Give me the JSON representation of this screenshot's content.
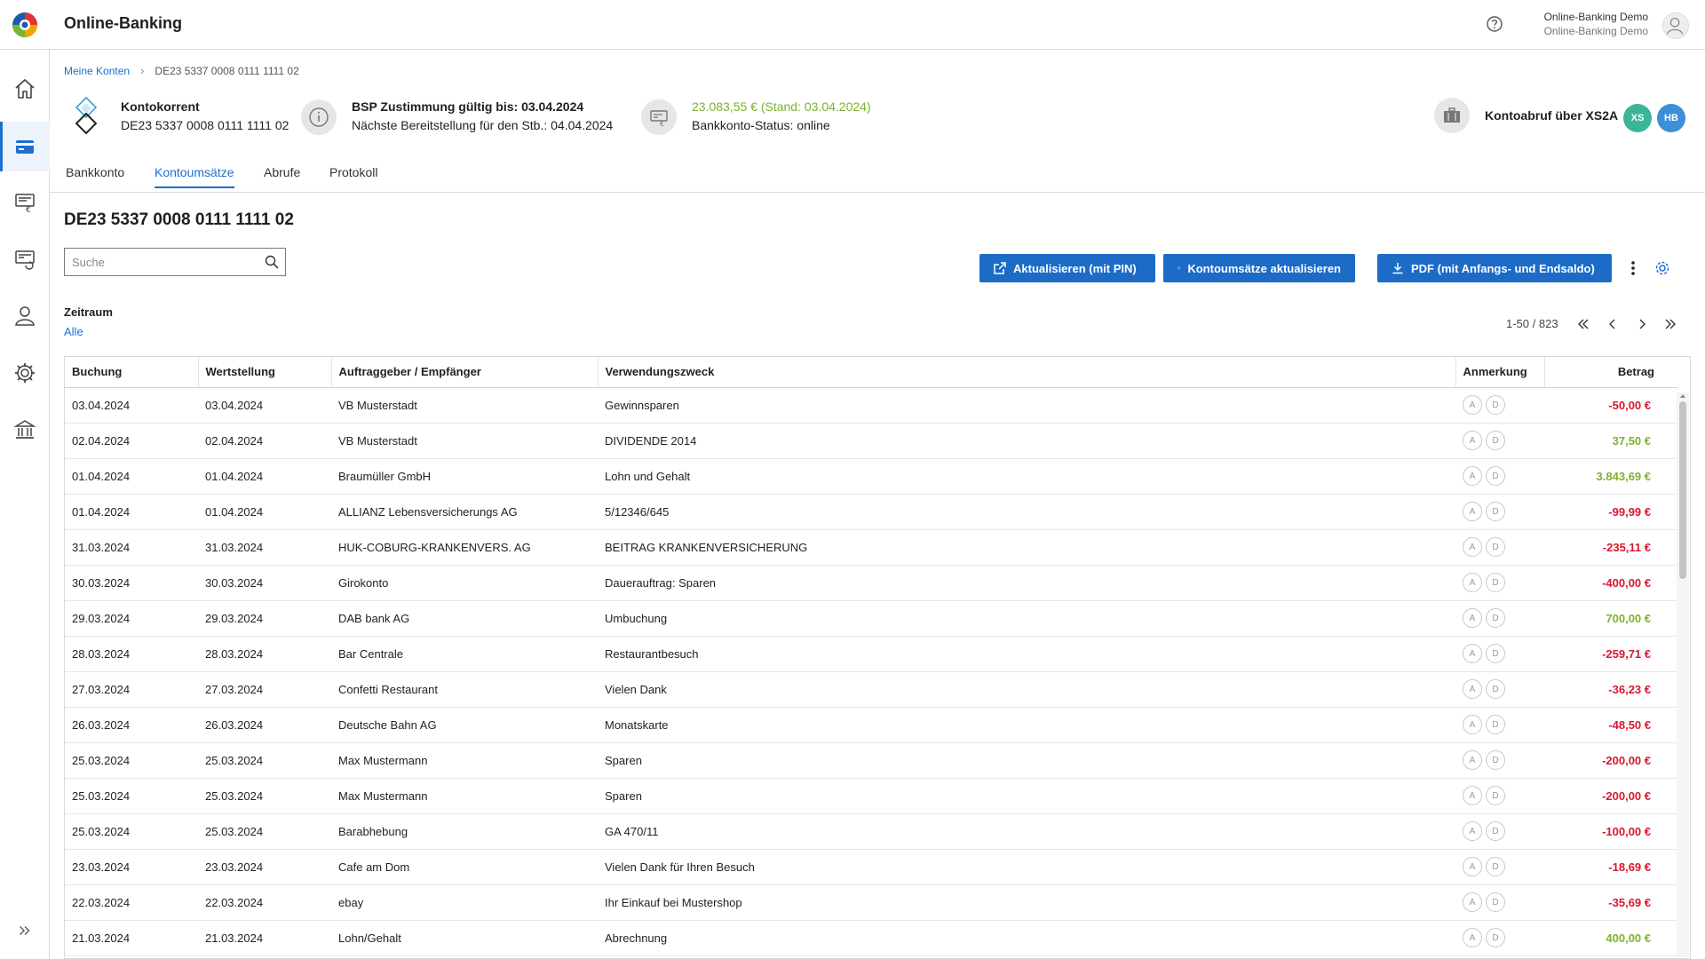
{
  "app": {
    "title": "Online-Banking"
  },
  "user": {
    "name": "Online-Banking Demo",
    "subtitle": "Online-Banking Demo"
  },
  "nav": {
    "items": [
      "home-icon",
      "accounts-icon",
      "transfer-icon",
      "standing-orders-icon",
      "user-icon",
      "gear-icon",
      "bank-icon"
    ],
    "active": "accounts-icon"
  },
  "breadcrumb": {
    "root": "Meine Konten",
    "current": "DE23 5337 0008 0111 1111 02"
  },
  "account": {
    "type": "Kontokorrent",
    "iban": "DE23 5337 0008 0111 1111 02",
    "bsp_line1": "BSP Zustimmung gültig bis: 03.04.2024",
    "bsp_line2": "Nächste Bereitstellung für den Stb.: 04.04.2024",
    "balance": "23.083,55 € (Stand: 03.04.2024)",
    "status": "Bankkonto-Status: online",
    "xs2a_label": "Kontoabruf über XS2A",
    "badge_xs": "XS",
    "badge_hb": "HB"
  },
  "tabs": [
    {
      "label": "Bankkonto",
      "active": false
    },
    {
      "label": "Kontoumsätze",
      "active": true
    },
    {
      "label": "Abrufe",
      "active": false
    },
    {
      "label": "Protokoll",
      "active": false
    }
  ],
  "page": {
    "heading": "DE23 5337 0008 0111 1111 02"
  },
  "search": {
    "placeholder": "Suche",
    "value": ""
  },
  "buttons": {
    "update_pin": "Aktualisieren (mit PIN)",
    "update_tx": "Kontoumsätze aktualisieren",
    "pdf": "PDF (mit Anfangs- und Endsaldo)"
  },
  "zeitraum": {
    "label": "Zeitraum",
    "value": "Alle"
  },
  "pagination": {
    "text": "1-50 / 823"
  },
  "table": {
    "columns": [
      "Buchung",
      "Wertstellung",
      "Auftraggeber / Empfänger",
      "Verwendungszweck",
      "Anmerkung",
      "Betrag"
    ],
    "rows": [
      {
        "buchung": "03.04.2024",
        "wert": "03.04.2024",
        "name": "VB Musterstadt",
        "zweck": "Gewinnsparen",
        "betrag": "-50,00 €",
        "sign": "neg"
      },
      {
        "buchung": "02.04.2024",
        "wert": "02.04.2024",
        "name": "VB Musterstadt",
        "zweck": "DIVIDENDE 2014",
        "betrag": "37,50 €",
        "sign": "pos"
      },
      {
        "buchung": "01.04.2024",
        "wert": "01.04.2024",
        "name": "Braumüller GmbH",
        "zweck": "Lohn und Gehalt",
        "betrag": "3.843,69 €",
        "sign": "pos"
      },
      {
        "buchung": "01.04.2024",
        "wert": "01.04.2024",
        "name": "ALLIANZ Lebensversicherungs AG",
        "zweck": "5/12346/645",
        "betrag": "-99,99 €",
        "sign": "neg"
      },
      {
        "buchung": "31.03.2024",
        "wert": "31.03.2024",
        "name": "HUK-COBURG-KRANKENVERS. AG",
        "zweck": "BEITRAG KRANKENVERSICHERUNG",
        "betrag": "-235,11 €",
        "sign": "neg"
      },
      {
        "buchung": "30.03.2024",
        "wert": "30.03.2024",
        "name": "Girokonto",
        "zweck": "Dauerauftrag: Sparen",
        "betrag": "-400,00 €",
        "sign": "neg"
      },
      {
        "buchung": "29.03.2024",
        "wert": "29.03.2024",
        "name": "DAB bank AG",
        "zweck": "Umbuchung",
        "betrag": "700,00 €",
        "sign": "pos"
      },
      {
        "buchung": "28.03.2024",
        "wert": "28.03.2024",
        "name": "Bar Centrale",
        "zweck": "Restaurantbesuch",
        "betrag": "-259,71 €",
        "sign": "neg"
      },
      {
        "buchung": "27.03.2024",
        "wert": "27.03.2024",
        "name": "Confetti Restaurant",
        "zweck": "Vielen Dank",
        "betrag": "-36,23 €",
        "sign": "neg"
      },
      {
        "buchung": "26.03.2024",
        "wert": "26.03.2024",
        "name": "Deutsche Bahn AG",
        "zweck": "Monatskarte",
        "betrag": "-48,50 €",
        "sign": "neg"
      },
      {
        "buchung": "25.03.2024",
        "wert": "25.03.2024",
        "name": "Max Mustermann",
        "zweck": "Sparen",
        "betrag": "-200,00 €",
        "sign": "neg"
      },
      {
        "buchung": "25.03.2024",
        "wert": "25.03.2024",
        "name": "Max Mustermann",
        "zweck": "Sparen",
        "betrag": "-200,00 €",
        "sign": "neg"
      },
      {
        "buchung": "25.03.2024",
        "wert": "25.03.2024",
        "name": "Barabhebung",
        "zweck": "GA 470/11",
        "betrag": "-100,00 €",
        "sign": "neg"
      },
      {
        "buchung": "23.03.2024",
        "wert": "23.03.2024",
        "name": "Cafe am Dom",
        "zweck": "Vielen Dank für Ihren Besuch",
        "betrag": "-18,69 €",
        "sign": "neg"
      },
      {
        "buchung": "22.03.2024",
        "wert": "22.03.2024",
        "name": "ebay",
        "zweck": "Ihr Einkauf bei Mustershop",
        "betrag": "-35,69 €",
        "sign": "neg"
      },
      {
        "buchung": "21.03.2024",
        "wert": "21.03.2024",
        "name": "Lohn/Gehalt",
        "zweck": "Abrechnung",
        "betrag": "400,00 €",
        "sign": "pos"
      }
    ],
    "note_labels": [
      "A",
      "D"
    ]
  },
  "colors": {
    "accent": "#1c6bc7",
    "negative": "#d8172f",
    "positive": "#7ab32e"
  }
}
